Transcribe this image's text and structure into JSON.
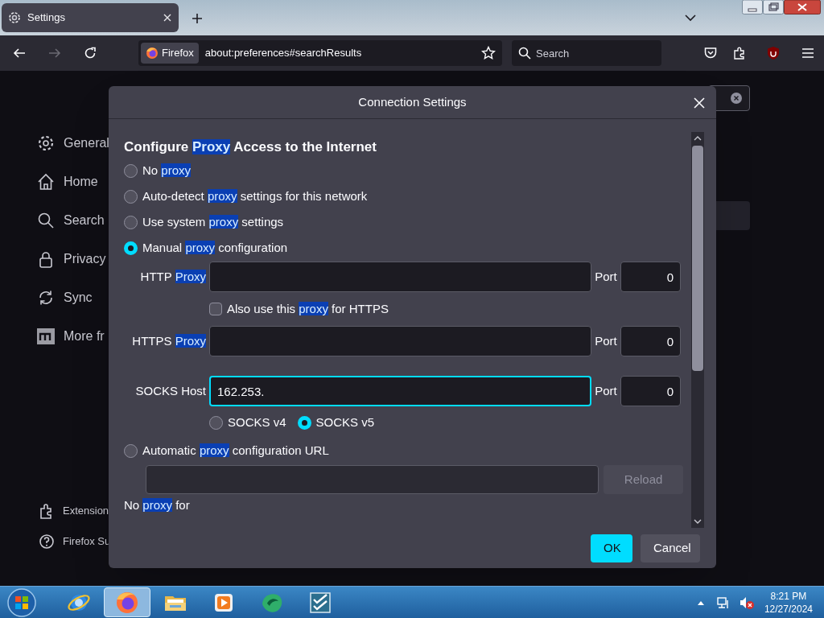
{
  "browser": {
    "tabs": [
      {
        "title": "Settings",
        "selected": true
      }
    ],
    "nav": {
      "forward_disabled": true
    },
    "address": {
      "identity": "Firefox",
      "url": "about:preferences#searchResults"
    },
    "search": {
      "placeholder": "Search"
    }
  },
  "sidebar": {
    "items": [
      {
        "kind": "gear",
        "label": "General"
      },
      {
        "kind": "house",
        "label": "Home"
      },
      {
        "kind": "search",
        "label": "Search"
      },
      {
        "kind": "lock",
        "label": "Privacy"
      },
      {
        "kind": "sync",
        "label": "Sync"
      },
      {
        "kind": "tile",
        "label": "More fr"
      }
    ],
    "footer": [
      {
        "kind": "puzzle",
        "label": "Extension"
      },
      {
        "kind": "help",
        "label": "Firefox Su"
      }
    ]
  },
  "dialog": {
    "title": "Connection Settings",
    "heading": [
      {
        "text": "Configure ",
        "highlight": false
      },
      {
        "text": "Proxy",
        "highlight": true
      },
      {
        "text": " Access to the Internet",
        "highlight": false
      }
    ],
    "rows": [
      {
        "kind": "radio",
        "selected": false,
        "label": [
          {
            "text": "No ",
            "highlight": false
          },
          {
            "text": "proxy",
            "highlight": true
          }
        ]
      },
      {
        "kind": "radio",
        "selected": false,
        "label": [
          {
            "text": "Auto-detect ",
            "highlight": false
          },
          {
            "text": "proxy",
            "highlight": true
          },
          {
            "text": " settings for this network",
            "highlight": false
          }
        ]
      },
      {
        "kind": "radio",
        "selected": false,
        "label": [
          {
            "text": "Use system ",
            "highlight": false
          },
          {
            "text": "proxy",
            "highlight": true
          },
          {
            "text": " settings",
            "highlight": false
          }
        ]
      },
      {
        "kind": "radio",
        "selected": true,
        "label": [
          {
            "text": "Manual ",
            "highlight": false
          },
          {
            "text": "proxy",
            "highlight": true
          },
          {
            "text": " configuration",
            "highlight": false
          }
        ]
      },
      {
        "kind": "host",
        "focused": false,
        "value": "",
        "port_label": "Port",
        "port": "0",
        "label": [
          {
            "text": "HTTP ",
            "highlight": false
          },
          {
            "text": "Proxy",
            "highlight": true
          }
        ]
      },
      {
        "kind": "checkbox",
        "checked": false,
        "label": [
          {
            "text": "Also use this ",
            "highlight": false
          },
          {
            "text": "proxy",
            "highlight": true
          },
          {
            "text": " for HTTPS",
            "highlight": false
          }
        ]
      },
      {
        "kind": "host",
        "focused": false,
        "value": "",
        "port_label": "Port",
        "port": "0",
        "label": [
          {
            "text": "HTTPS ",
            "highlight": false
          },
          {
            "text": "Proxy",
            "highlight": true
          }
        ]
      },
      {
        "kind": "host",
        "focused": true,
        "value": "162.253.",
        "port_label": "Port",
        "port": "0",
        "label": [
          {
            "text": "SOCKS Host",
            "highlight": false
          }
        ]
      },
      {
        "kind": "versions",
        "options": [
          {
            "label": "SOCKS v4",
            "selected": false
          },
          {
            "label": "SOCKS v5",
            "selected": true
          }
        ]
      },
      {
        "kind": "radio",
        "selected": false,
        "label": [
          {
            "text": "Automatic ",
            "highlight": false
          },
          {
            "text": "proxy",
            "highlight": true
          },
          {
            "text": " configuration URL",
            "highlight": false
          }
        ]
      },
      {
        "kind": "url",
        "value": "",
        "button": "Reload",
        "button_disabled": true
      },
      {
        "kind": "text",
        "label": [
          {
            "text": "No ",
            "highlight": false
          },
          {
            "text": "proxy",
            "highlight": true
          },
          {
            "text": " for",
            "highlight": false
          }
        ]
      }
    ],
    "buttons": [
      {
        "label": "OK",
        "primary": true
      },
      {
        "label": "Cancel",
        "primary": false
      }
    ]
  },
  "taskbar": {
    "apps": [
      {
        "kind": "ie",
        "selected": false
      },
      {
        "kind": "firefox",
        "selected": true
      },
      {
        "kind": "folder",
        "selected": false
      },
      {
        "kind": "media",
        "selected": false
      },
      {
        "kind": "blob",
        "selected": false
      },
      {
        "kind": "checklist",
        "selected": false
      }
    ],
    "clock": {
      "time": "8:21 PM",
      "date": "12/27/2024"
    }
  }
}
